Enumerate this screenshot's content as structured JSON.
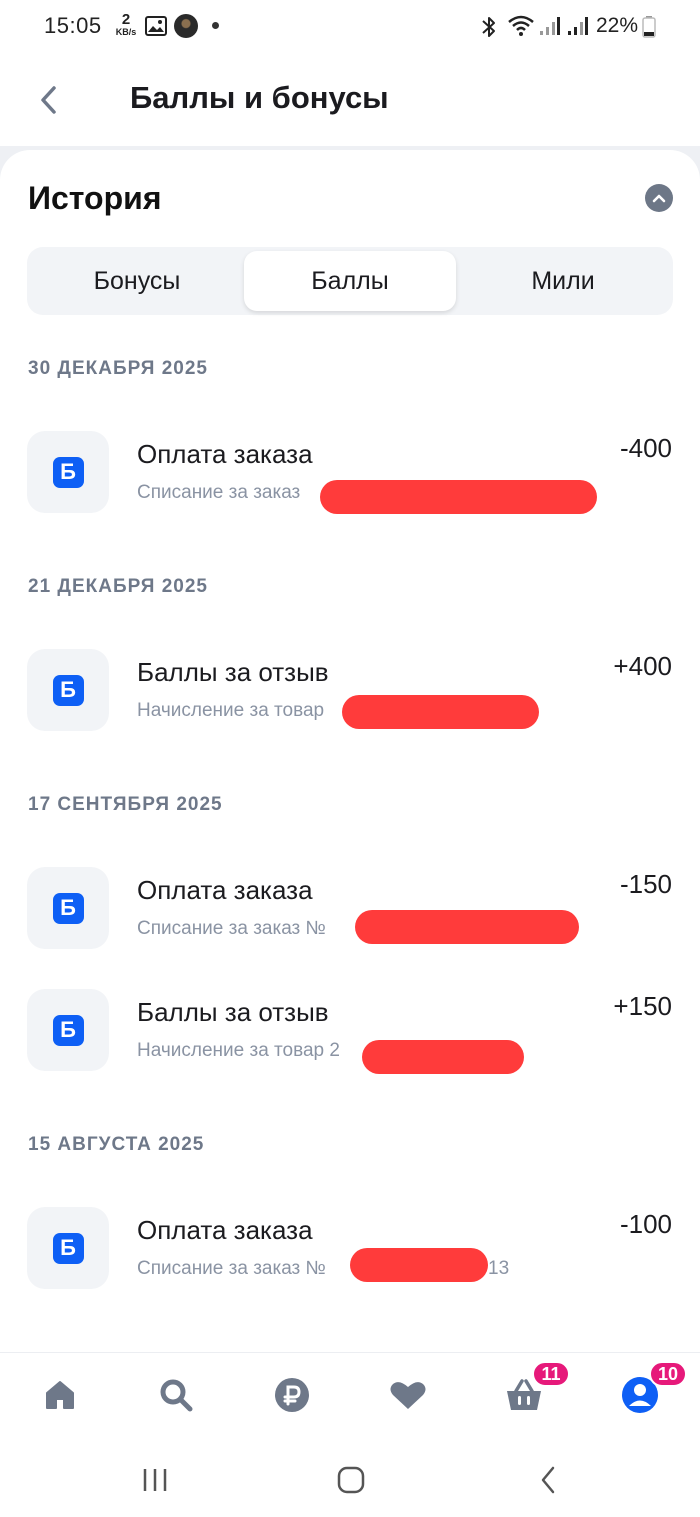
{
  "status_bar": {
    "time": "15:05",
    "net_speed_value": "2",
    "net_speed_unit": "KB/s",
    "battery": "22%"
  },
  "header": {
    "title": "Баллы и бонусы",
    "back_icon": "chevron-left-icon"
  },
  "history": {
    "title": "История",
    "collapse_icon": "chevron-up-icon"
  },
  "tabs": [
    {
      "label": "Бонусы",
      "active": false
    },
    {
      "label": "Баллы",
      "active": true
    },
    {
      "label": "Мили",
      "active": false
    }
  ],
  "groups": [
    {
      "date": "30 ДЕКАБРЯ 2025",
      "items": [
        {
          "icon_letter": "Б",
          "title": "Оплата заказа",
          "subtitle": "Списание за заказ",
          "amount": "-400"
        }
      ]
    },
    {
      "date": "21 ДЕКАБРЯ 2025",
      "items": [
        {
          "icon_letter": "Б",
          "title": "Баллы за отзыв",
          "subtitle": "Начисление за товар",
          "amount": "+400"
        }
      ]
    },
    {
      "date": "17 СЕНТЯБРЯ 2025",
      "items": [
        {
          "icon_letter": "Б",
          "title": "Оплата заказа",
          "subtitle": "Списание за заказ №",
          "amount": "-150"
        },
        {
          "icon_letter": "Б",
          "title": "Баллы за отзыв",
          "subtitle": "Начисление за товар 2",
          "amount": "+150"
        }
      ]
    },
    {
      "date": "15 АВГУСТА 2025",
      "items": [
        {
          "icon_letter": "Б",
          "title": "Оплата заказа",
          "subtitle": "Списание за заказ №",
          "subtitle_tail": "13",
          "amount": "-100"
        }
      ]
    }
  ],
  "bottom_nav": {
    "items": [
      "home-icon",
      "search-icon",
      "ruble-icon",
      "heart-icon",
      "basket-icon",
      "profile-icon"
    ],
    "basket_badge": "11",
    "profile_badge": "10",
    "accent": "#0e5ff5",
    "badge_color": "#e6197a"
  },
  "colors": {
    "accent": "#0e5ff5",
    "muted_text": "#8a93a3",
    "redaction": "#ff3b3b"
  }
}
